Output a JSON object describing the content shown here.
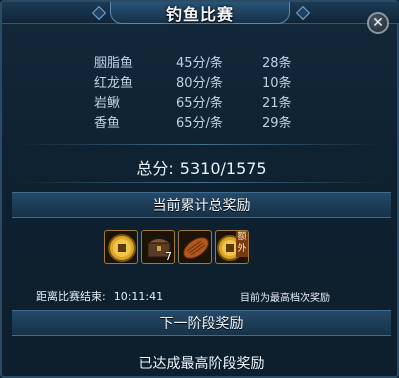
{
  "window": {
    "title": "钓鱼比赛"
  },
  "fish": [
    {
      "name": "胭脂鱼",
      "price": "45分/条",
      "count": "28条"
    },
    {
      "name": "红龙鱼",
      "price": "80分/条",
      "count": "10条"
    },
    {
      "name": "岩鳅",
      "price": "65分/条",
      "count": "21条"
    },
    {
      "name": "香鱼",
      "price": "65分/条",
      "count": "29条"
    }
  ],
  "total": {
    "label": "总分:",
    "value": "5310/1575"
  },
  "current_reward": {
    "title": "当前累计总奖励",
    "items": [
      {
        "icon": "gold-coin-icon",
        "count": ""
      },
      {
        "icon": "treasure-chest-icon",
        "count": "7"
      },
      {
        "icon": "roasted-fish-icon",
        "count": ""
      },
      {
        "icon": "gold-coin-bonus-icon",
        "count": "",
        "tag": "额外"
      }
    ]
  },
  "countdown": {
    "label": "距离比赛结束:",
    "time": "10:11:41"
  },
  "rank_note": "目前为最高档次奖励",
  "next_stage": {
    "title": "下一阶段奖励",
    "text": "已达成最高阶段奖励"
  }
}
